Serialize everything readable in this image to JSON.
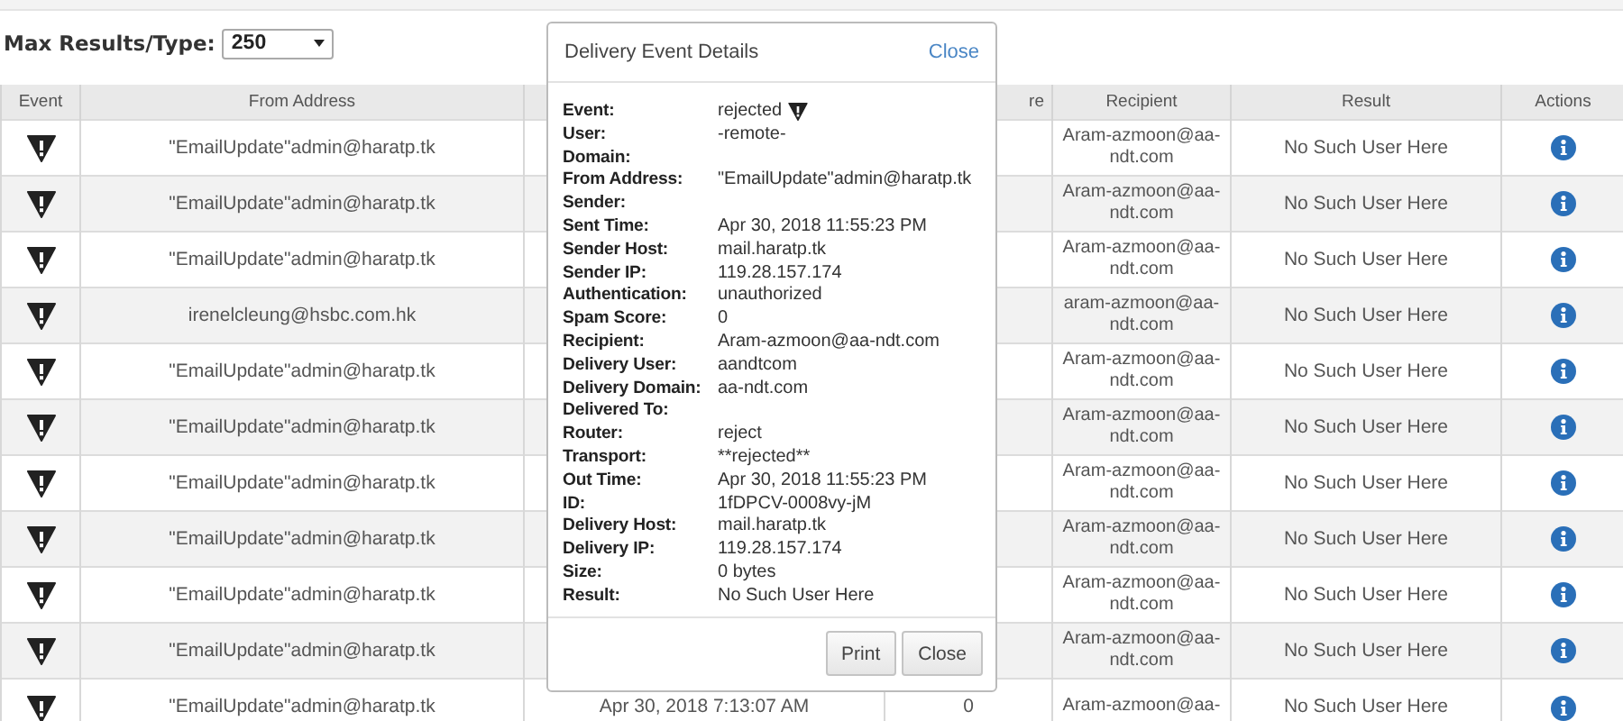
{
  "filter": {
    "label": "Max Results/Type:",
    "value": "250"
  },
  "table": {
    "columns": [
      "Event",
      "From Address",
      "",
      "re",
      "Recipient",
      "Result",
      "Actions"
    ],
    "rows": [
      {
        "from": "\"EmailUpdate\"admin@haratp.tk",
        "recipient": "Aram-azmoon@aa-ndt.com",
        "result": "No Such User Here"
      },
      {
        "from": "\"EmailUpdate\"admin@haratp.tk",
        "recipient": "Aram-azmoon@aa-ndt.com",
        "result": "No Such User Here"
      },
      {
        "from": "\"EmailUpdate\"admin@haratp.tk",
        "recipient": "Aram-azmoon@aa-ndt.com",
        "result": "No Such User Here"
      },
      {
        "from": "irenelcleung@hsbc.com.hk",
        "recipient": "aram-azmoon@aa-ndt.com",
        "result": "No Such User Here"
      },
      {
        "from": "\"EmailUpdate\"admin@haratp.tk",
        "recipient": "Aram-azmoon@aa-ndt.com",
        "result": "No Such User Here"
      },
      {
        "from": "\"EmailUpdate\"admin@haratp.tk",
        "recipient": "Aram-azmoon@aa-ndt.com",
        "result": "No Such User Here"
      },
      {
        "from": "\"EmailUpdate\"admin@haratp.tk",
        "recipient": "Aram-azmoon@aa-ndt.com",
        "result": "No Such User Here"
      },
      {
        "from": "\"EmailUpdate\"admin@haratp.tk",
        "recipient": "Aram-azmoon@aa-ndt.com",
        "result": "No Such User Here"
      },
      {
        "from": "\"EmailUpdate\"admin@haratp.tk",
        "recipient": "Aram-azmoon@aa-ndt.com",
        "result": "No Such User Here"
      },
      {
        "from": "\"EmailUpdate\"admin@haratp.tk",
        "recipient": "Aram-azmoon@aa-ndt.com",
        "result": "No Such User Here"
      },
      {
        "from": "\"EmailUpdate\"admin@haratp.tk",
        "time": "Apr 30, 2018 7:13:07 AM",
        "spam": "0",
        "recipient": "Aram-azmoon@aa-",
        "result": "No Such User Here"
      }
    ]
  },
  "dialog": {
    "title": "Delivery Event Details",
    "close_link": "Close",
    "fields": [
      {
        "label": "Event:",
        "value": "rejected",
        "kind": "event"
      },
      {
        "label": "User:",
        "value": "-remote-"
      },
      {
        "label": "Domain:"
      },
      {
        "label": "From Address:",
        "value": "\"EmailUpdate\"admin@haratp.tk"
      },
      {
        "label": "Sender:"
      },
      {
        "label": "Sent Time:",
        "value": "Apr 30, 2018 11:55:23 PM"
      },
      {
        "label": "Sender Host:",
        "value": "mail.haratp.tk"
      },
      {
        "label": "Sender IP:",
        "value": "119.28.157.174"
      },
      {
        "label": "Authentication:",
        "value": "unauthorized"
      },
      {
        "label": "Spam Score:",
        "value": "0"
      },
      {
        "label": "Recipient:",
        "value": "Aram-azmoon@aa-ndt.com"
      },
      {
        "label": "Delivery User:",
        "value": "aandtcom"
      },
      {
        "label": "Delivery Domain:",
        "value": "aa-ndt.com"
      },
      {
        "label": "Delivered To:"
      },
      {
        "label": "Router:",
        "value": "reject"
      },
      {
        "label": "Transport:",
        "value": "**rejected**"
      },
      {
        "label": "Out Time:",
        "value": "Apr 30, 2018 11:55:23 PM"
      },
      {
        "label": "ID:",
        "value": "1fDPCV-0008vy-jM"
      },
      {
        "label": "Delivery Host:",
        "value": "mail.haratp.tk"
      },
      {
        "label": "Delivery IP:",
        "value": "119.28.157.174"
      },
      {
        "label": "Size:",
        "value": "0 bytes"
      },
      {
        "label": "Result:",
        "value": "No Such User Here"
      }
    ],
    "buttons": [
      "Print",
      "Close"
    ]
  }
}
